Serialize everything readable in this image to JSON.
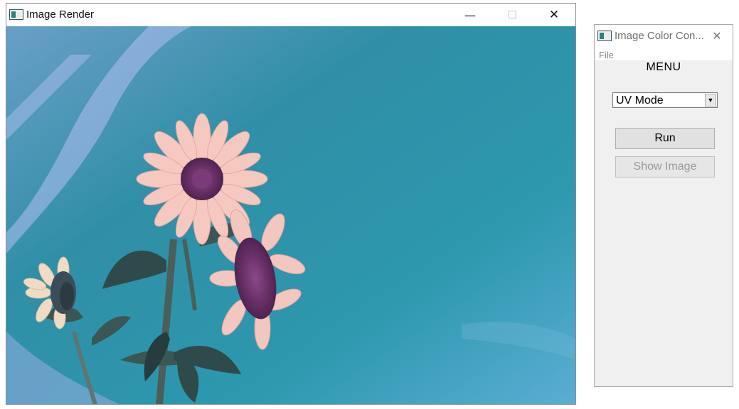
{
  "render_window": {
    "title": "Image Render",
    "minimize_glyph": "—",
    "maximize_glyph": "☐",
    "close_glyph": "✕"
  },
  "converter_window": {
    "title": "Image Color Con...",
    "close_glyph": "✕",
    "menu": {
      "file_label": "File"
    },
    "heading": "MENU",
    "mode_select": {
      "value": "UV Mode",
      "arrow_glyph": "▼"
    },
    "run_label": "Run",
    "show_image_label": "Show Image"
  },
  "colors": {
    "sky": "#2e95aa",
    "petal": "#f6c9c0",
    "disk": "#6a2f66",
    "leaf": "#2f4a4a"
  }
}
